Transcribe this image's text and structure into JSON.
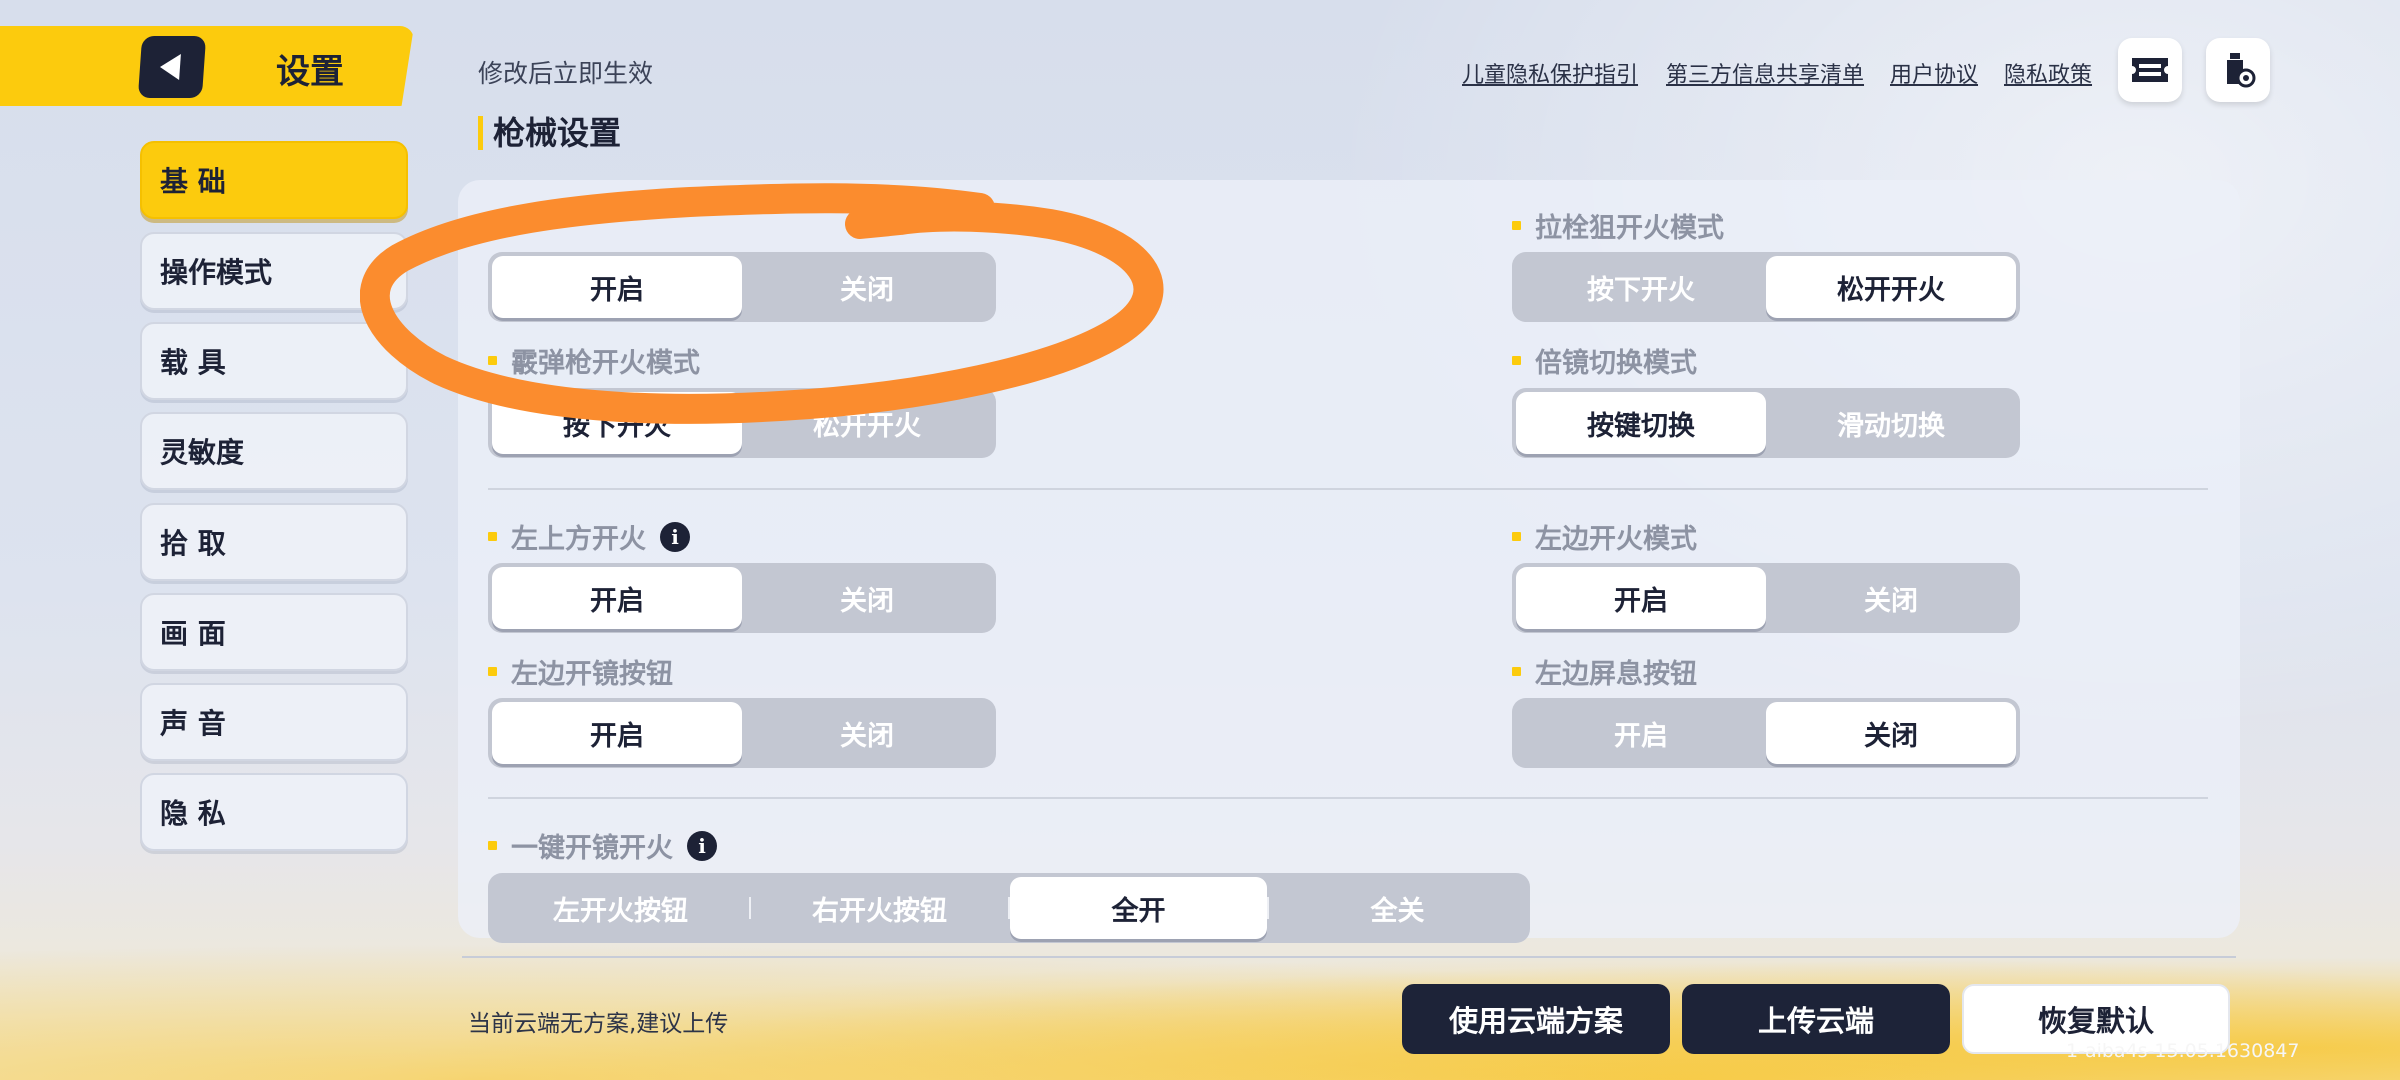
{
  "header": {
    "title": "设置",
    "back_icon": "back-arrow-icon"
  },
  "sidebar": {
    "items": [
      {
        "label": "基 础",
        "active": true
      },
      {
        "label": "操作模式",
        "active": false
      },
      {
        "label": "载 具",
        "active": false
      },
      {
        "label": "灵敏度",
        "active": false
      },
      {
        "label": "拾 取",
        "active": false
      },
      {
        "label": "画 面",
        "active": false
      },
      {
        "label": "声 音",
        "active": false
      },
      {
        "label": "隐 私",
        "active": false
      }
    ]
  },
  "top": {
    "notice": "修改后立即生效",
    "links": [
      "儿童隐私保护指引",
      "第三方信息共享清单",
      "用户协议",
      "隐私政策"
    ],
    "icons": [
      "ticket-icon",
      "bottle-settings-icon"
    ]
  },
  "section_title": "枪械设置",
  "options": {
    "first_toggle": {
      "on": "开启",
      "off": "关闭",
      "selected": "开启"
    },
    "shotgun_fire_mode": {
      "label": "霰弹枪开火模式",
      "on": "按下开火",
      "off": "松开开火",
      "selected": "按下开火"
    },
    "bolt_sniper_fire_mode": {
      "label": "拉栓狙开火模式",
      "a": "按下开火",
      "b": "松开开火",
      "selected": "松开开火"
    },
    "scope_switch_mode": {
      "label": "倍镜切换模式",
      "a": "按键切换",
      "b": "滑动切换",
      "selected": "按键切换"
    },
    "top_left_fire": {
      "label": "左上方开火",
      "on": "开启",
      "off": "关闭",
      "selected": "开启"
    },
    "left_fire_mode": {
      "label": "左边开火模式",
      "on": "开启",
      "off": "关闭",
      "selected": "开启"
    },
    "left_scope_button": {
      "label": "左边开镜按钮",
      "on": "开启",
      "off": "关闭",
      "selected": "开启"
    },
    "left_hold_breath_button": {
      "label": "左边屏息按钮",
      "on": "开启",
      "off": "关闭",
      "selected": "关闭"
    },
    "one_key_scope_fire": {
      "label": "一键开镜开火",
      "options": [
        "左开火按钮",
        "右开火按钮",
        "全开",
        "全关"
      ],
      "selected": "全开"
    }
  },
  "footer": {
    "cloud_tip": "当前云端无方案,建议上传",
    "use_cloud": "使用云端方案",
    "upload_cloud": "上传云端",
    "restore_default": "恢复默认",
    "version": "1-aiba4s-15.05.1630847"
  },
  "colors": {
    "accent": "#fccb0d",
    "dark": "#1d2338",
    "annotation": "#fb8c2e"
  }
}
